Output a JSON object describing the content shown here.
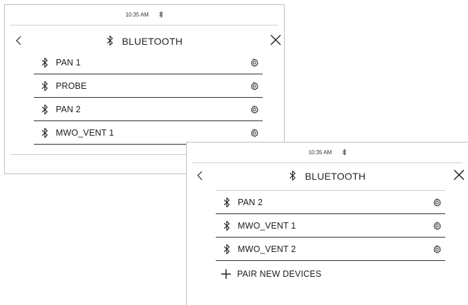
{
  "screen1": {
    "status_time": "10:35 AM",
    "title": "BLUETOOTH",
    "devices": [
      {
        "label": "PAN 1"
      },
      {
        "label": "PROBE"
      },
      {
        "label": "PAN 2"
      },
      {
        "label": "MWO_VENT 1"
      }
    ]
  },
  "screen2": {
    "status_time": "10:35 AM",
    "title": "BLUETOOTH",
    "devices": [
      {
        "label": "PAN 2"
      },
      {
        "label": "MWO_VENT 1"
      },
      {
        "label": "MWO_VENT 2"
      }
    ],
    "pair_label": "PAIR NEW DEVICES"
  }
}
